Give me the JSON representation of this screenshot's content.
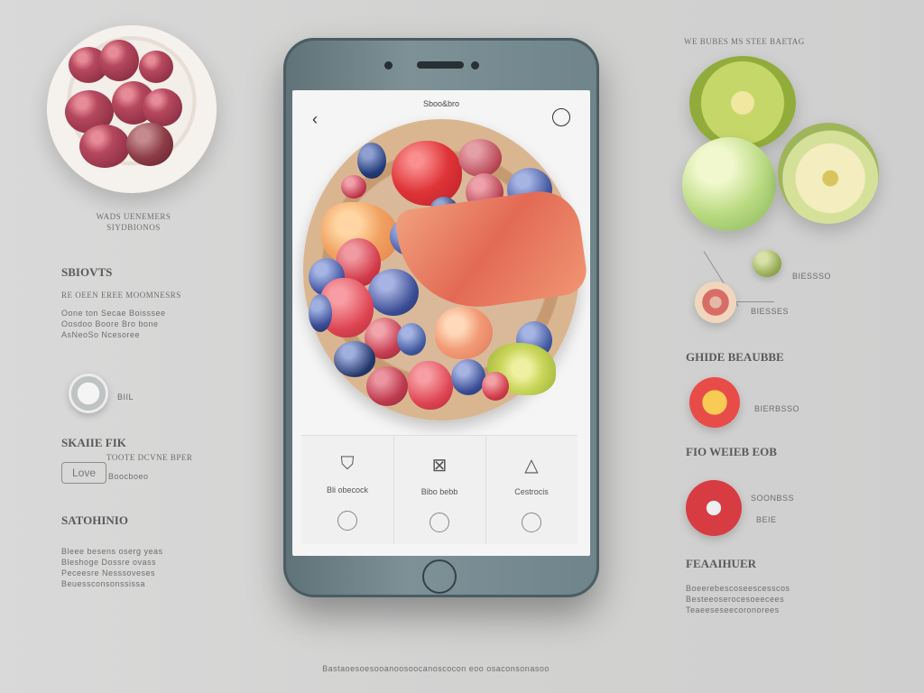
{
  "left": {
    "bowl_caption": "WADS UENEMERS\nSIYDBIONOS",
    "section1_heading": "SBIOVTS",
    "section1_sub": "RE OEEN EREE MOOMNESRS",
    "section1_body": "Oone ton Secae Boisssee\nOosdoo Boore Bro bone\nAsNeoSo Ncesoree",
    "toggle_label": "BIIL",
    "section2_heading": "SKAIIE FIK",
    "section2_sub": "TOOTE DCVNE BPER",
    "logo_text": "Love",
    "logo_side": "Boocboeo",
    "section3_heading": "SATOHINIO",
    "section3_body": "Bleee besens oserg yeas\nBleshoge Dossre ovass\nPeceesre Nesssoveses\nBeuessconsonssissa"
  },
  "phone": {
    "status_title": "Sboo&bro",
    "bottom": [
      {
        "icon": "shield-icon",
        "label": "Bli obecock"
      },
      {
        "icon": "image-icon",
        "label": "Bibo bebb"
      },
      {
        "icon": "triangle-icon",
        "label": "Cestrocis"
      }
    ]
  },
  "right": {
    "top_label": "WE BUBES MS STEE BAETAG",
    "fruit_label_1": "BIESSSO",
    "fruit_label_2": "BIESSES",
    "section_heading": "GHIDE BEAUBBE",
    "orb1_label": "BIERBSSO",
    "section2_heading": "FIO WEIEB EOB",
    "orb2_label": "SOONBSS",
    "orb2_sub": "BEIE",
    "section3_heading": "FEAAIHUER",
    "section3_body": "Boeerebescoseescesscos\nBesteeoserocesoeecees\nTeaeeseseecoronorees"
  },
  "footer": {
    "caption": "Bastaoesoesooanoosoocanoscocon eoo osaconsonasoo"
  },
  "colors": {
    "background": "#d6d6d6",
    "phone": "#6f848b",
    "screen": "#f5f5f5"
  }
}
